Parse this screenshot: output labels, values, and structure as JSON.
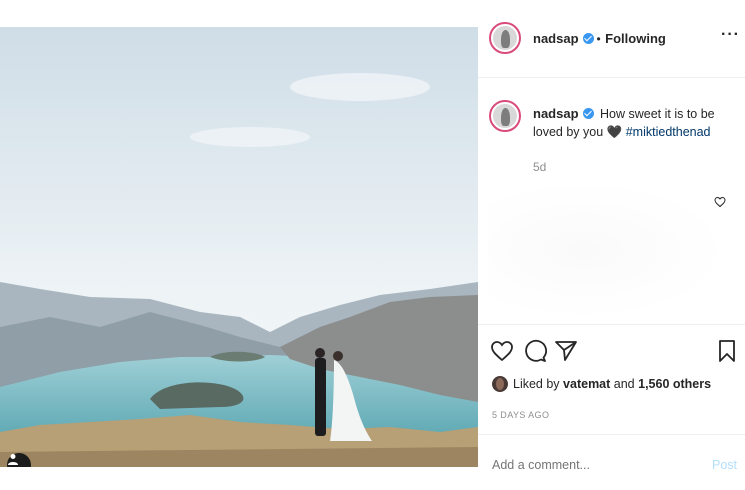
{
  "post": {
    "username": "nadsap",
    "follow_separator": "•",
    "follow_status": "Following",
    "more_label": "···",
    "caption_username": "nadsap",
    "caption_text": "How sweet it is to be loved by you",
    "caption_emoji": "🖤",
    "hashtag": "#miktiedthenad",
    "time_ago": "5d",
    "liked_prefix": "Liked by",
    "liked_user": "vatemat",
    "liked_and": "and",
    "liked_count": "1,560 others",
    "date": "5 DAYS AGO",
    "comment_placeholder": "Add a comment...",
    "post_label": "Post"
  },
  "colors": {
    "verified": "#3897f0",
    "hashtag": "#00376b",
    "story_ring": "#d94b7a",
    "post_button": "#b2dffc"
  },
  "icons": [
    "verified-badge-icon",
    "more-options-icon",
    "heart-icon",
    "comment-icon",
    "share-icon",
    "bookmark-icon",
    "tag-user-icon"
  ]
}
